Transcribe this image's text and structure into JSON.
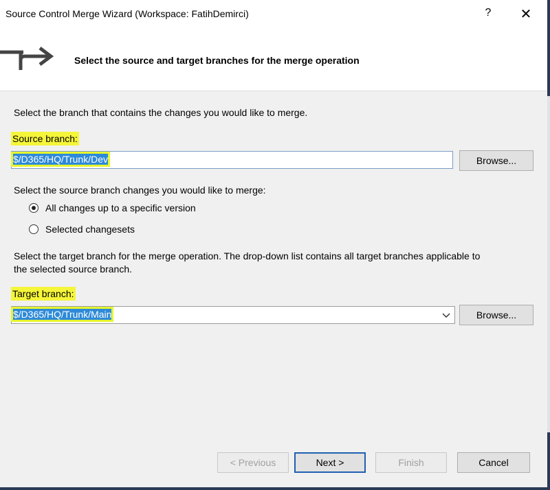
{
  "window": {
    "title": "Source Control Merge Wizard (Workspace: FatihDemirci)",
    "help_label": "?",
    "close_label": "✕"
  },
  "header": {
    "title": "Select the source and target branches for the merge operation",
    "icon": "merge-arrow-icon"
  },
  "source": {
    "instruction": "Select the branch that contains the changes you would like to merge.",
    "label": "Source branch:",
    "value": "$/D365/HQ/Trunk/Dev",
    "browse_label": "Browse..."
  },
  "changes": {
    "instruction": "Select the source branch changes you would like to merge:",
    "options": [
      {
        "label": "All changes up to a specific version",
        "selected": true
      },
      {
        "label": "Selected changesets",
        "selected": false
      }
    ]
  },
  "target": {
    "instruction_line1": "Select the target branch for the merge operation.  The drop-down list contains all target branches applicable to",
    "instruction_line2": "the selected source branch.",
    "label": "Target branch:",
    "value": "$/D365/HQ/Trunk/Main",
    "browse_label": "Browse..."
  },
  "footer": {
    "previous_label": "< Previous",
    "next_label": "Next >",
    "finish_label": "Finish",
    "cancel_label": "Cancel"
  },
  "colors": {
    "highlight": "#f5f53a",
    "selection": "#2d8ad8",
    "accent_border": "#1f5fb0"
  }
}
